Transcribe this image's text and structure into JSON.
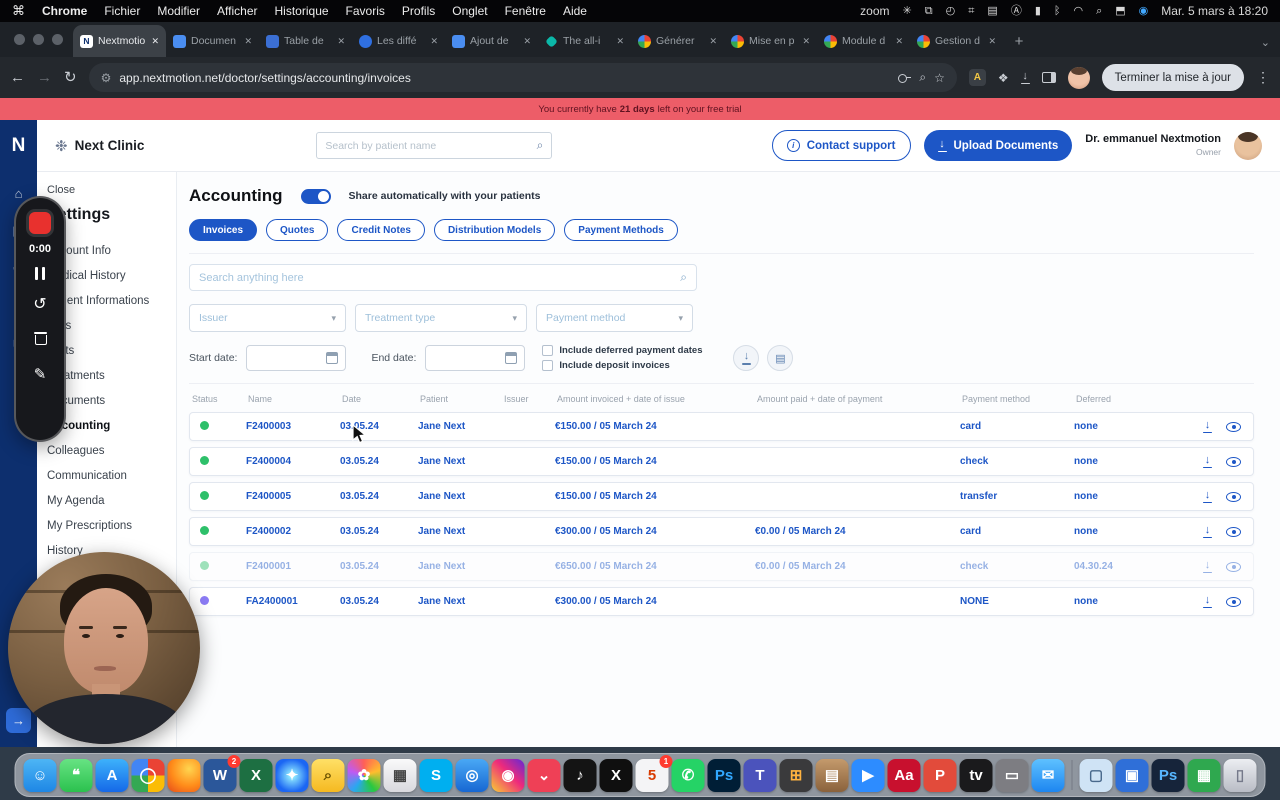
{
  "menubar": {
    "items": [
      {
        "label": "Chrome",
        "cls": "bold"
      },
      {
        "label": "Fichier"
      },
      {
        "label": "Modifier"
      },
      {
        "label": "Afficher"
      },
      {
        "label": "Historique"
      },
      {
        "label": "Favoris"
      },
      {
        "label": "Profils"
      },
      {
        "label": "Onglet"
      },
      {
        "label": "Fenêtre"
      },
      {
        "label": "Aide"
      }
    ],
    "zoom_label": "zoom",
    "status_icons": [
      {
        "name": "pinwheel-icon",
        "glyph": "✳"
      },
      {
        "name": "stack-icon",
        "glyph": "⧉"
      },
      {
        "name": "screen-record-icon",
        "glyph": "◴"
      },
      {
        "name": "grid-icon",
        "glyph": "⌗"
      },
      {
        "name": "keyboard-icon",
        "glyph": "▤"
      },
      {
        "name": "input-source-icon",
        "glyph": "Ⓐ"
      },
      {
        "name": "battery-icon",
        "glyph": "▮"
      },
      {
        "name": "bluetooth-icon",
        "glyph": "ᛒ"
      },
      {
        "name": "wifi-icon",
        "glyph": "◠"
      },
      {
        "name": "spotlight-icon",
        "glyph": "⌕"
      },
      {
        "name": "control-center-icon",
        "glyph": "⬒"
      },
      {
        "name": "siri-icon",
        "glyph": "◉",
        "fg": "#41a8ff"
      }
    ],
    "clock": "Mar. 5 mars à 18:20"
  },
  "browser": {
    "tabs": [
      {
        "label": "Nextmotio",
        "fav": "nm",
        "active": true
      },
      {
        "label": "Documen",
        "fav": "doc"
      },
      {
        "label": "Table de",
        "fav": "grid"
      },
      {
        "label": "Les diffé",
        "fav": "blue"
      },
      {
        "label": "Ajout de",
        "fav": "doc"
      },
      {
        "label": "The all-i",
        "fav": "teal"
      },
      {
        "label": "Générer",
        "fav": "pin"
      },
      {
        "label": "Mise en p",
        "fav": "pin"
      },
      {
        "label": "Module d",
        "fav": "pin"
      },
      {
        "label": "Gestion d",
        "fav": "pin"
      }
    ],
    "url": "app.nextmotion.net/doctor/settings/accounting/invoices",
    "update_button": "Terminer la mise à jour"
  },
  "banner": {
    "prefix": "You currently have",
    "highlight": "21 days",
    "suffix": "left on your free trial"
  },
  "header": {
    "logo_letter": "N",
    "brand": "Next Clinic",
    "search_placeholder": "Search by patient name",
    "contact_support": "Contact support",
    "upload_documents": "Upload Documents",
    "user_name": "Dr. emmanuel Nextmotion",
    "user_role": "Owner"
  },
  "navstrip": {
    "icons": [
      {
        "name": "home-icon",
        "glyph": "⌂"
      },
      {
        "name": "patients-icon",
        "glyph": "▤"
      },
      {
        "name": "add-icon",
        "glyph": "✚"
      },
      {
        "name": "clock-icon",
        "glyph": "◔"
      },
      {
        "name": "mail-icon",
        "glyph": "✉"
      }
    ]
  },
  "sidebar": {
    "close_label": "Close",
    "title": "Settings",
    "items": [
      {
        "label": "Account Info"
      },
      {
        "label": "Medical History"
      },
      {
        "label": "Patient Informations"
      },
      {
        "label": "Tags"
      },
      {
        "label": "Visits"
      },
      {
        "label": "Treatments"
      },
      {
        "label": "Documents"
      },
      {
        "label": "Accounting",
        "active": true
      },
      {
        "label": "Colleagues"
      },
      {
        "label": "Communication"
      },
      {
        "label": "My Agenda"
      },
      {
        "label": "My Prescriptions"
      },
      {
        "label": "History"
      }
    ]
  },
  "recorder": {
    "time": "0:00"
  },
  "main": {
    "title": "Accounting",
    "share_label": "Share automatically with your patients",
    "tabs": [
      {
        "label": "Invoices",
        "active": true
      },
      {
        "label": "Quotes"
      },
      {
        "label": "Credit Notes"
      },
      {
        "label": "Distribution Models"
      },
      {
        "label": "Payment Methods"
      }
    ],
    "search_placeholder": "Search anything here",
    "filters": [
      {
        "label": "Issuer"
      },
      {
        "label": "Treatment type"
      },
      {
        "label": "Payment method"
      }
    ],
    "start_date_label": "Start date:",
    "end_date_label": "End date:",
    "checkboxes": [
      {
        "label": "Include deferred payment dates"
      },
      {
        "label": "Include deposit invoices"
      }
    ],
    "table": {
      "columns": [
        {
          "label": "Status"
        },
        {
          "label": "Name"
        },
        {
          "label": "Date"
        },
        {
          "label": "Patient"
        },
        {
          "label": "Issuer"
        },
        {
          "label": "Amount invoiced + date of issue"
        },
        {
          "label": "Amount paid + date of payment"
        },
        {
          "label": "Payment method"
        },
        {
          "label": "Deferred"
        }
      ],
      "rows": [
        {
          "status": "green",
          "name": "F2400003",
          "date": "03.05.24",
          "patient": "Jane Next",
          "issuer": "",
          "invoiced": "€150.00 / 05 March 24",
          "paid": "",
          "method": "card",
          "deferred": "none"
        },
        {
          "status": "green",
          "name": "F2400004",
          "date": "03.05.24",
          "patient": "Jane Next",
          "issuer": "",
          "invoiced": "€150.00 / 05 March 24",
          "paid": "",
          "method": "check",
          "deferred": "none"
        },
        {
          "status": "green",
          "name": "F2400005",
          "date": "03.05.24",
          "patient": "Jane Next",
          "issuer": "",
          "invoiced": "€150.00 / 05 March 24",
          "paid": "",
          "method": "transfer",
          "deferred": "none"
        },
        {
          "status": "green",
          "name": "F2400002",
          "date": "03.05.24",
          "patient": "Jane Next",
          "issuer": "",
          "invoiced": "€300.00 / 05 March 24",
          "paid": "€0.00 / 05 March 24",
          "method": "card",
          "deferred": "none"
        },
        {
          "status": "green",
          "faded": true,
          "name": "F2400001",
          "date": "03.05.24",
          "patient": "Jane Next",
          "issuer": "",
          "invoiced": "€650.00 / 05 March 24",
          "paid": "€0.00 / 05 March 24",
          "method": "check",
          "deferred": "04.30.24"
        },
        {
          "status": "purple",
          "name": "FA2400001",
          "date": "03.05.24",
          "patient": "Jane Next",
          "issuer": "",
          "invoiced": "€300.00 / 05 March 24",
          "paid": "",
          "method": "NONE",
          "deferred": "none"
        }
      ]
    }
  },
  "dock": {
    "items": [
      {
        "name": "finder",
        "glyph": "☺",
        "bg": "linear-gradient(180deg,#4db5f5,#1e87e5)"
      },
      {
        "name": "messages",
        "glyph": "❝",
        "bg": "linear-gradient(180deg,#67e383,#2bc14e)"
      },
      {
        "name": "app-store",
        "glyph": "A",
        "bg": "linear-gradient(180deg,#3db1fb,#1569e8)"
      },
      {
        "name": "chrome",
        "glyph": "◯",
        "bg": "conic-gradient(#ea4335 0 25%,#fbbc05 0 50%,#34a853 0 75%,#4285f4 0)"
      },
      {
        "name": "firefox",
        "glyph": "",
        "bg": "radial-gradient(circle at 65% 30%,#ffd54f,#ff8c1a 55%,#e64a19)"
      },
      {
        "name": "word",
        "glyph": "W",
        "bg": "#2b579a",
        "badge": "2"
      },
      {
        "name": "excel",
        "glyph": "X",
        "bg": "#1d6f42"
      },
      {
        "name": "safari",
        "glyph": "✦",
        "bg": "radial-gradient(circle,#8ee8ff 10%,#1b66f3 70%)"
      },
      {
        "name": "preview",
        "glyph": "⌕",
        "bg": "linear-gradient(180deg,#ffe066,#f5b921)",
        "fg": "#6b5200"
      },
      {
        "name": "photos",
        "glyph": "✿",
        "bg": "conic-gradient(#ff5f57,#ffbd2e,#28c840,#2aa7f0,#bf5af2,#ff5f57)"
      },
      {
        "name": "keyboard",
        "glyph": "▦",
        "bg": "linear-gradient(180deg,#fafafa,#d9d9de)",
        "fg": "#444"
      },
      {
        "name": "skype",
        "glyph": "S",
        "bg": "#00aff0"
      },
      {
        "name": "blue-app",
        "glyph": "◎",
        "bg": "linear-gradient(180deg,#49a8f5,#1767d2)"
      },
      {
        "name": "instagram",
        "glyph": "◉",
        "bg": "linear-gradient(45deg,#f9ce34,#ee2a7b 55%,#6228d7)"
      },
      {
        "name": "pocket",
        "glyph": "⌄",
        "bg": "#ef4056"
      },
      {
        "name": "tiktok",
        "glyph": "♪",
        "bg": "#141414"
      },
      {
        "name": "x-app",
        "glyph": "X",
        "bg": "#0f0f0f"
      },
      {
        "name": "ms365",
        "glyph": "5",
        "bg": "#f4f4f6",
        "fg": "#d83b01",
        "badge": "1"
      },
      {
        "name": "whatsapp",
        "glyph": "✆",
        "bg": "#25d366"
      },
      {
        "name": "photoshop",
        "glyph": "Ps",
        "bg": "#001e36",
        "fg": "#31a8ff"
      },
      {
        "name": "teams",
        "glyph": "T",
        "bg": "#4b53bc"
      },
      {
        "name": "calculator",
        "glyph": "⊞",
        "bg": "#3a3a3c",
        "fg": "#ffb340"
      },
      {
        "name": "notes-app",
        "glyph": "▤",
        "bg": "linear-gradient(180deg,#c49a6c,#8a623c)"
      },
      {
        "name": "zoom-app",
        "glyph": "▶",
        "bg": "#2d8cff"
      },
      {
        "name": "fonts-app",
        "glyph": "Aa",
        "bg": "#c8102e"
      },
      {
        "name": "pdf-app",
        "glyph": "P",
        "bg": "#e24b3b"
      },
      {
        "name": "apple-tv",
        "glyph": "tv",
        "bg": "#1a1a1c"
      },
      {
        "name": "displays",
        "glyph": "▭",
        "bg": "#7d7d82"
      },
      {
        "name": "mail",
        "glyph": "✉",
        "bg": "linear-gradient(180deg,#5ec1ff,#1d86f0)"
      }
    ],
    "right_items": [
      {
        "name": "finder-window",
        "glyph": "▢",
        "bg": "#cfe3f5",
        "fg": "#49698c"
      },
      {
        "name": "blue-doc",
        "glyph": "▣",
        "bg": "#2f6fd8"
      },
      {
        "name": "photoshop-beta",
        "glyph": "Ps",
        "bg": "#16243a",
        "fg": "#57b6ff"
      },
      {
        "name": "green-app",
        "glyph": "▦",
        "bg": "#2fa84f"
      },
      {
        "name": "trash",
        "glyph": "▯",
        "bg": "linear-gradient(180deg,#eceef2,#b9bcc5)",
        "fg": "#75798a"
      }
    ]
  },
  "colors": {
    "accent": "#1d56c6",
    "navy": "#0d2f6e",
    "banner": "#ed5d68",
    "status_green": "#2ec06a",
    "status_purple": "#8b7bf4"
  }
}
